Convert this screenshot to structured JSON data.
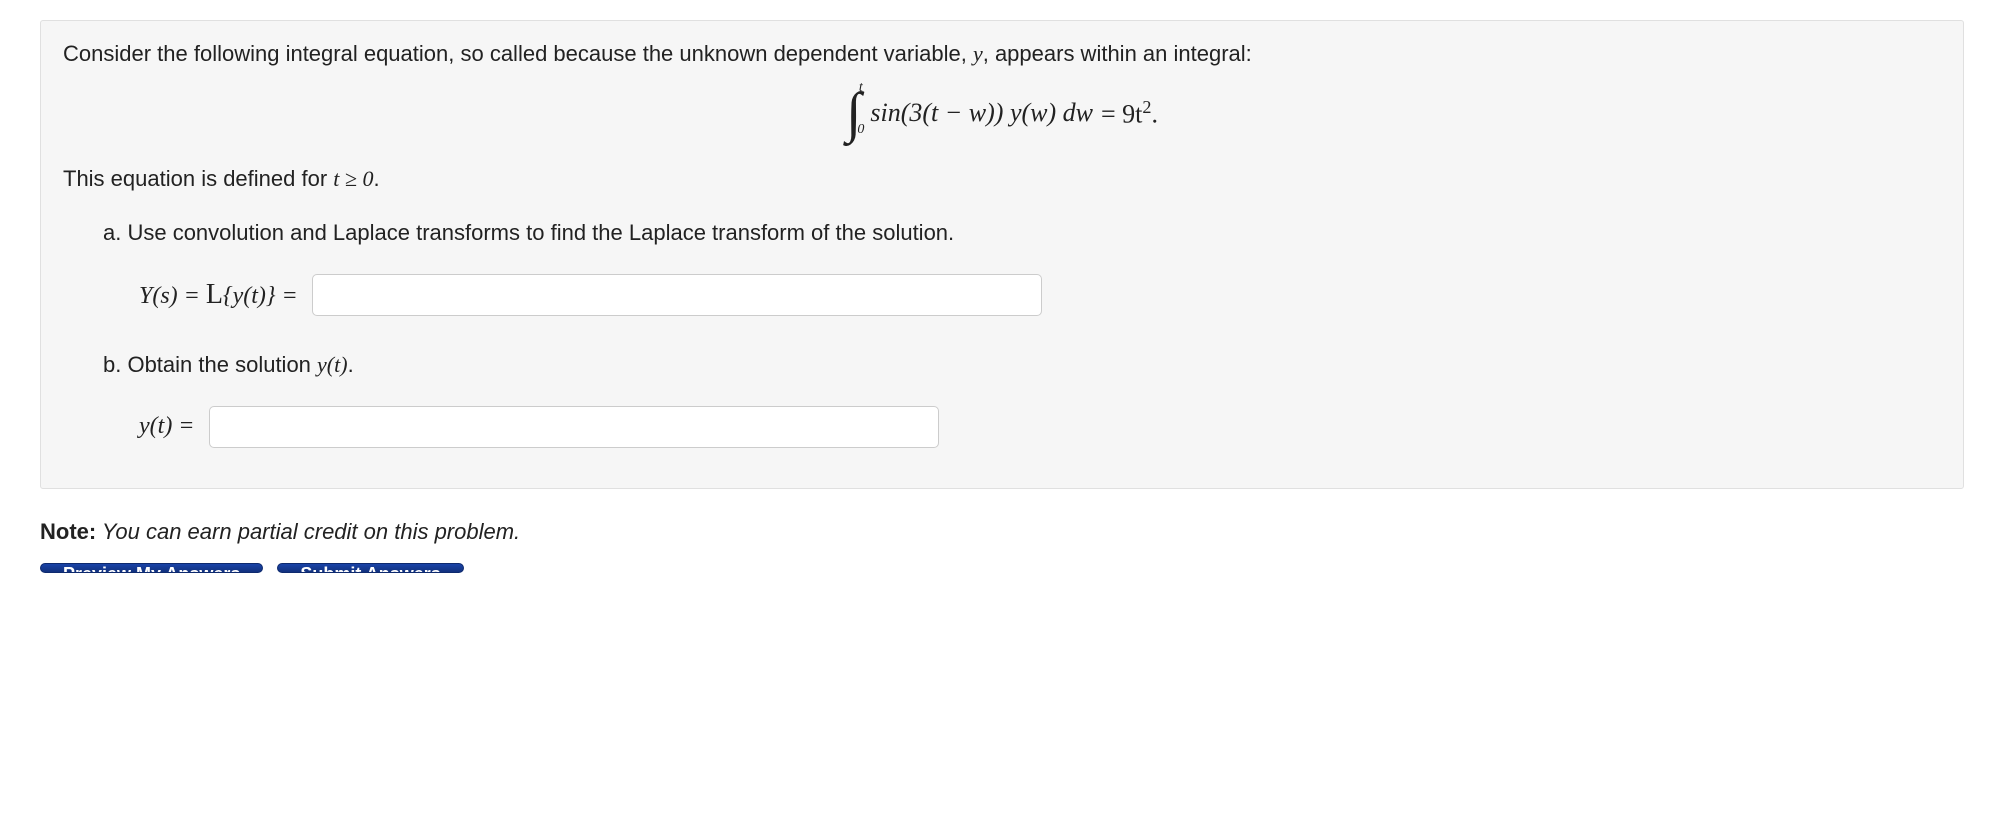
{
  "problem": {
    "intro_prefix": "Consider the following integral equation, so called because the unknown dependent variable, ",
    "intro_var": "y",
    "intro_suffix": ", appears within an integral:",
    "equation": {
      "upper_bound": "t",
      "lower_bound": "0",
      "integrand": "sin(3(t − w)) y(w) dw",
      "rhs": "= 9t",
      "rhs_exp": "2",
      "rhs_period": "."
    },
    "defined_prefix": "This equation is defined for ",
    "defined_math": "t ≥ 0",
    "defined_period": ".",
    "part_a": {
      "prompt": "a. Use convolution and Laplace transforms to find the Laplace transform of the solution.",
      "label_lhs": "Y(s) = ",
      "label_script": "L",
      "label_braces": "{y(t)} = "
    },
    "part_b": {
      "prompt_prefix": "b. Obtain the solution ",
      "prompt_var": "y(t)",
      "prompt_suffix": ".",
      "label": "y(t) = "
    }
  },
  "note": {
    "bold": "Note:",
    "italic": " You can earn partial credit on this problem."
  },
  "buttons": {
    "preview": "Preview My Answers",
    "submit": "Submit Answers"
  }
}
